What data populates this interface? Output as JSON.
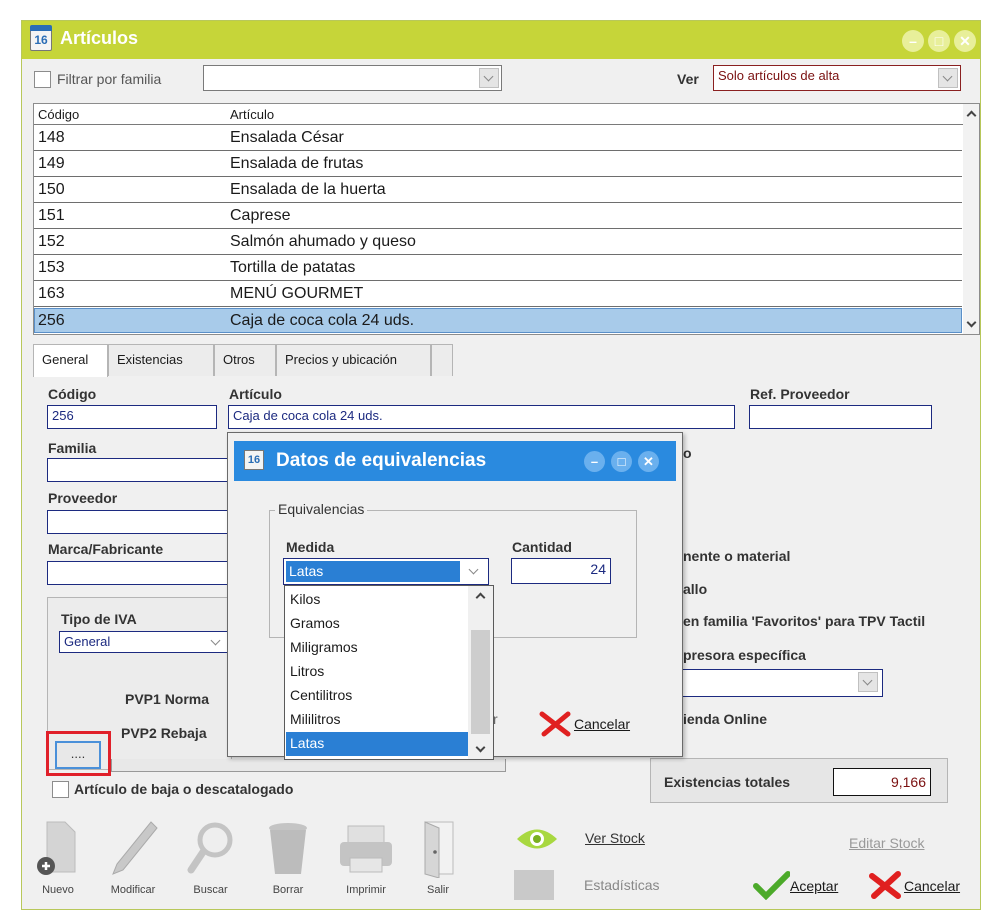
{
  "window": {
    "title": "Artículos",
    "icon_text": "16",
    "buttons": [
      "–",
      "□",
      "✕"
    ]
  },
  "filter": {
    "label": "Filtrar por familia",
    "value": "",
    "ver_label": "Ver",
    "ver_value": "Solo artículos de alta"
  },
  "grid": {
    "columns": [
      "Código",
      "Artículo"
    ],
    "rows": [
      {
        "code": "148",
        "name": "Ensalada César"
      },
      {
        "code": "149",
        "name": "Ensalada de frutas"
      },
      {
        "code": "150",
        "name": "Ensalada de la huerta"
      },
      {
        "code": "151",
        "name": "Caprese"
      },
      {
        "code": "152",
        "name": "Salmón ahumado y queso"
      },
      {
        "code": "153",
        "name": "Tortilla de patatas"
      },
      {
        "code": "163",
        "name": "MENÚ GOURMET"
      },
      {
        "code": "256",
        "name": "Caja de coca cola 24 uds."
      }
    ],
    "selected_code": "256"
  },
  "tabs": [
    "General",
    "Existencias",
    "Otros",
    "Precios y ubicación"
  ],
  "form": {
    "codigo_label": "Código",
    "codigo_value": "256",
    "articulo_label": "Artículo",
    "articulo_value": "Caja de coca cola 24 uds.",
    "ref_label": "Ref. Proveedor",
    "ref_value": "",
    "familia_label": "Familia",
    "proveedor_label": "Proveedor",
    "marca_label": "Marca/Fabricante",
    "tipo_iva_label": "Tipo de IVA",
    "tipo_iva_value": "General",
    "pvp1_label": "PVP1 Norma",
    "pvp2_label": "PVP2 Rebaja",
    "dots_button": "....",
    "baja_label": "Artículo de baja o descatalogado",
    "right_fragment_o": "o",
    "componente_label": "nente o material",
    "detallo_label": "allo",
    "favoritos_label": "en familia 'Favoritos' para TPV Tactil",
    "impresora_label": "presora específica",
    "tienda_label": "ienda Online",
    "existencias_label": "Existencias totales",
    "existencias_value": "9,166"
  },
  "dialog": {
    "title": "Datos de equivalencias",
    "icon_text": "16",
    "group_label": "Equivalencias",
    "medida_label": "Medida",
    "medida_value": "Latas",
    "cantidad_label": "Cantidad",
    "cantidad_value": "24",
    "options": [
      "Kilos",
      "Gramos",
      "Miligramos",
      "Litros",
      "Centilitros",
      "Mililitros",
      "Latas"
    ],
    "selected_option": "Latas",
    "hidden_accept_fragment": "r",
    "cancel_label": "Cancelar"
  },
  "toolbar": {
    "nuevo": "Nuevo",
    "modificar": "Modificar",
    "buscar": "Buscar",
    "borrar": "Borrar",
    "imprimir": "Imprimir",
    "salir": "Salir",
    "ver_stock": "Ver Stock",
    "estadisticas": "Estadísticas",
    "editar_stock": "Editar Stock",
    "aceptar": "Aceptar",
    "cancelar": "Cancelar"
  },
  "colors": {
    "titlebar": "#c6d539",
    "dialog_title": "#2a8adf",
    "selection": "#a8cbea",
    "highlight_box": "#e0202a",
    "field_text_navy": "#1c2a80"
  }
}
